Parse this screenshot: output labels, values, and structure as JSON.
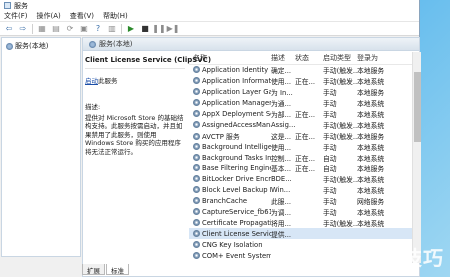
{
  "window": {
    "title": "服务"
  },
  "menu": [
    "文件(F)",
    "操作(A)",
    "查看(V)",
    "帮助(H)"
  ],
  "tree": {
    "root_label": "服务(本地)"
  },
  "main": {
    "header": "服务(本地)"
  },
  "detail": {
    "service_name": "Client License Service (ClipSVC)",
    "start_link": "启动",
    "start_suffix": "此服务",
    "desc_label": "描述:",
    "desc_text": "提供对 Microsoft Store 的基础结构支持。此服务按需启动，并且如果禁用了此服务，则使用 Windows Store 购买的应用程序将无法正常运行。"
  },
  "columns": {
    "name": "名称",
    "desc": "描述",
    "status": "状态",
    "startup": "启动类型",
    "logon": "登录为"
  },
  "services": [
    {
      "name": "Application Identity",
      "desc": "确定...",
      "status": "",
      "startup": "手动(触发...",
      "logon": "本地服务"
    },
    {
      "name": "Application Information",
      "desc": "使用...",
      "status": "正在...",
      "startup": "手动(触发...",
      "logon": "本地系统"
    },
    {
      "name": "Application Layer Gateway ...",
      "desc": "为 In...",
      "status": "",
      "startup": "手动",
      "logon": "本地服务"
    },
    {
      "name": "Application Management",
      "desc": "为通...",
      "status": "",
      "startup": "手动",
      "logon": "本地系统"
    },
    {
      "name": "AppX Deployment Service (...",
      "desc": "为部...",
      "status": "正在...",
      "startup": "手动",
      "logon": "本地系统"
    },
    {
      "name": "AssignedAccessManager ...",
      "desc": "Assig...",
      "status": "",
      "startup": "手动(触发...",
      "logon": "本地系统"
    },
    {
      "name": "AVCTP 服务",
      "desc": "这是...",
      "status": "正在...",
      "startup": "手动(触发...",
      "logon": "本地服务"
    },
    {
      "name": "Background Intelligent Tra...",
      "desc": "使用...",
      "status": "",
      "startup": "手动",
      "logon": "本地系统"
    },
    {
      "name": "Background Tasks Infrastru...",
      "desc": "控制...",
      "status": "正在...",
      "startup": "自动",
      "logon": "本地系统"
    },
    {
      "name": "Base Filtering Engine",
      "desc": "基本...",
      "status": "正在...",
      "startup": "自动",
      "logon": "本地服务"
    },
    {
      "name": "BitLocker Drive Encryption ...",
      "desc": "BDE...",
      "status": "",
      "startup": "手动(触发...",
      "logon": "本地系统"
    },
    {
      "name": "Block Level Backup Engine ...",
      "desc": "Win...",
      "status": "",
      "startup": "手动",
      "logon": "本地系统"
    },
    {
      "name": "BranchCache",
      "desc": "此服...",
      "status": "",
      "startup": "手动",
      "logon": "网络服务"
    },
    {
      "name": "CaptureService_fb61c",
      "desc": "为调...",
      "status": "",
      "startup": "手动",
      "logon": "本地系统"
    },
    {
      "name": "Certificate Propagation",
      "desc": "将用...",
      "status": "",
      "startup": "手动(触发...",
      "logon": "本地系统"
    },
    {
      "name": "Client License Service (Clip...",
      "desc": "提供...",
      "status": "",
      "startup": "",
      "logon": ""
    },
    {
      "name": "CNG Key Isolation",
      "desc": "",
      "status": "",
      "startup": "",
      "logon": ""
    },
    {
      "name": "COM+ Event System",
      "desc": "",
      "status": "",
      "startup": "",
      "logon": ""
    }
  ],
  "selected_index": 15,
  "tabs": [
    "扩展",
    "标准"
  ],
  "watermark": "软件技巧"
}
